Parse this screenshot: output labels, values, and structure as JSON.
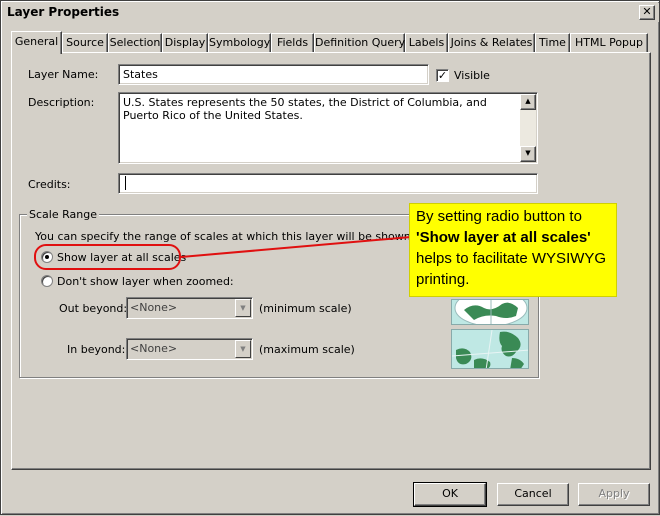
{
  "window": {
    "title": "Layer Properties",
    "close_glyph": "✕"
  },
  "tabs": [
    {
      "label": "General",
      "active": true
    },
    {
      "label": "Source"
    },
    {
      "label": "Selection"
    },
    {
      "label": "Display"
    },
    {
      "label": "Symbology"
    },
    {
      "label": "Fields"
    },
    {
      "label": "Definition Query"
    },
    {
      "label": "Labels"
    },
    {
      "label": "Joins & Relates"
    },
    {
      "label": "Time"
    },
    {
      "label": "HTML Popup"
    }
  ],
  "general": {
    "layer_name_label": "Layer Name:",
    "layer_name_value": "States",
    "visible_label": "Visible",
    "visible_checked": true,
    "description_label": "Description:",
    "description_value": "U.S. States represents the 50 states, the District of Columbia, and Puerto Rico of the United States.",
    "credits_label": "Credits:",
    "credits_value": ""
  },
  "scale_range": {
    "title": "Scale Range",
    "intro": "You can specify the range of scales at which this layer will be shown:",
    "option_all": "Show layer at all scales",
    "option_zoomed": "Don't show layer when zoomed:",
    "selected": "all",
    "out_beyond_label": "Out beyond:",
    "out_beyond_value": "<None>",
    "out_beyond_hint": "(minimum scale)",
    "in_beyond_label": "In beyond:",
    "in_beyond_value": "<None>",
    "in_beyond_hint": "(maximum scale)"
  },
  "callout": {
    "line1": "By setting radio button to",
    "line2": "'Show layer at all scales'",
    "line3": "helps to facilitate WYSIWYG",
    "line4": "printing.",
    "color": "#ffff00",
    "highlight_color": "#e01010"
  },
  "buttons": {
    "ok": "OK",
    "cancel": "Cancel",
    "apply": "Apply"
  }
}
